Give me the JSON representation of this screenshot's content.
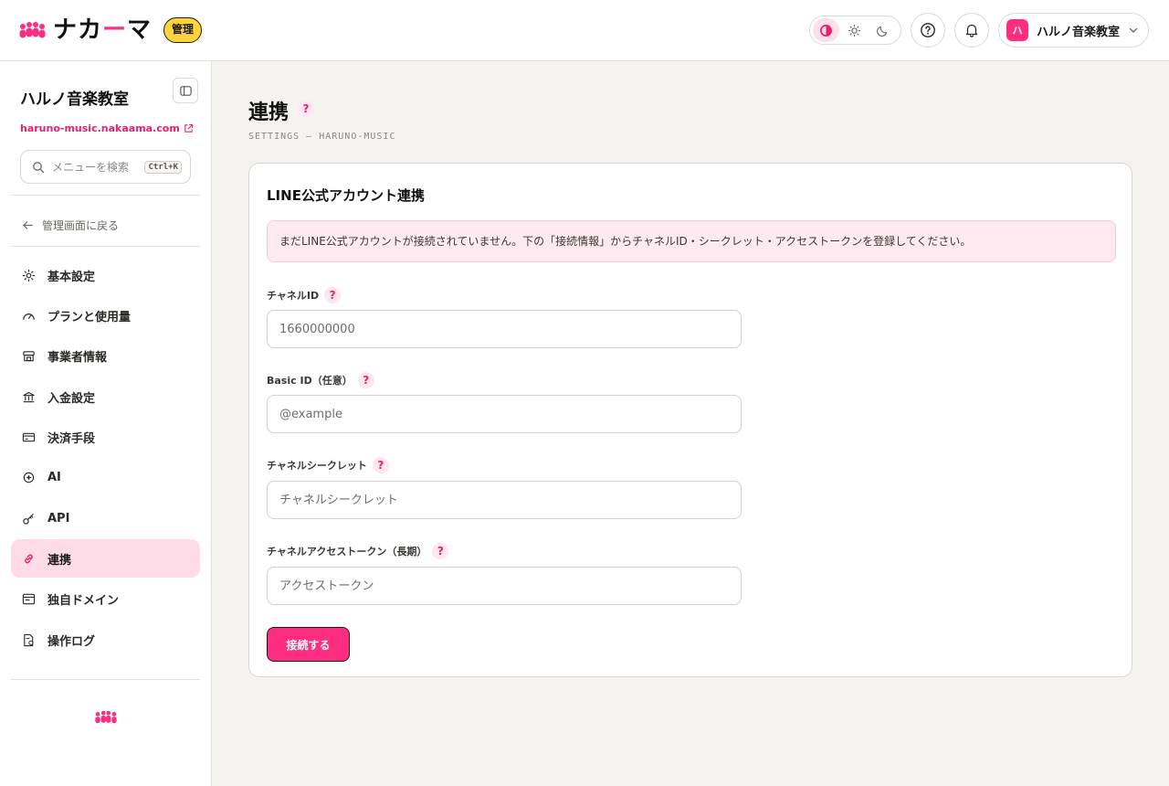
{
  "header": {
    "logo_text_a": "ナカ",
    "logo_text_accent": "ー",
    "logo_text_b": "マ",
    "admin_badge": "管理",
    "theme_options": [
      "contrast-icon",
      "sun-icon",
      "moon-icon"
    ],
    "account_avatar": "ハ",
    "account_name": "ハルノ音楽教室"
  },
  "sidebar": {
    "org_name": "ハルノ音楽教室",
    "org_url": "haruno-music.nakaama.com",
    "search_placeholder": "メニューを検索",
    "search_shortcut": "Ctrl+K",
    "back_label": "管理画面に戻る",
    "items": [
      {
        "label": "基本設定",
        "icon": "gear-icon"
      },
      {
        "label": "プランと使用量",
        "icon": "gauge-icon"
      },
      {
        "label": "事業者情報",
        "icon": "store-icon"
      },
      {
        "label": "入金設定",
        "icon": "bank-icon"
      },
      {
        "label": "決済手段",
        "icon": "credit-card-icon"
      },
      {
        "label": "AI",
        "icon": "ai-icon"
      },
      {
        "label": "API",
        "icon": "key-icon"
      },
      {
        "label": "連携",
        "icon": "link-icon",
        "active": true
      },
      {
        "label": "独自ドメイン",
        "icon": "browser-icon"
      },
      {
        "label": "操作ログ",
        "icon": "log-file-icon"
      }
    ]
  },
  "main": {
    "title": "連携",
    "subtitle": "SETTINGS — HARUNO-MUSIC",
    "help_mark": "?",
    "card": {
      "title": "LINE公式アカウント連携",
      "alert": "まだLINE公式アカウントが接続されていません。下の「接続情報」からチャネルID・シークレット・アクセストークンを登録してください。",
      "fields": [
        {
          "label": "チャネルID",
          "placeholder": "1660000000",
          "value": ""
        },
        {
          "label": "Basic ID（任意）",
          "placeholder": "@example",
          "value": ""
        },
        {
          "label": "チャネルシークレット",
          "placeholder": "チャネルシークレット",
          "value": ""
        },
        {
          "label": "チャネルアクセストークン（長期）",
          "placeholder": "アクセストークン",
          "value": ""
        }
      ],
      "submit_label": "接続する"
    }
  },
  "colors": {
    "accent": "#ff2d7f",
    "badge_yellow": "#ffd43b",
    "active_nav_bg": "#ffdbe8",
    "alert_bg": "#fdeaf0"
  }
}
